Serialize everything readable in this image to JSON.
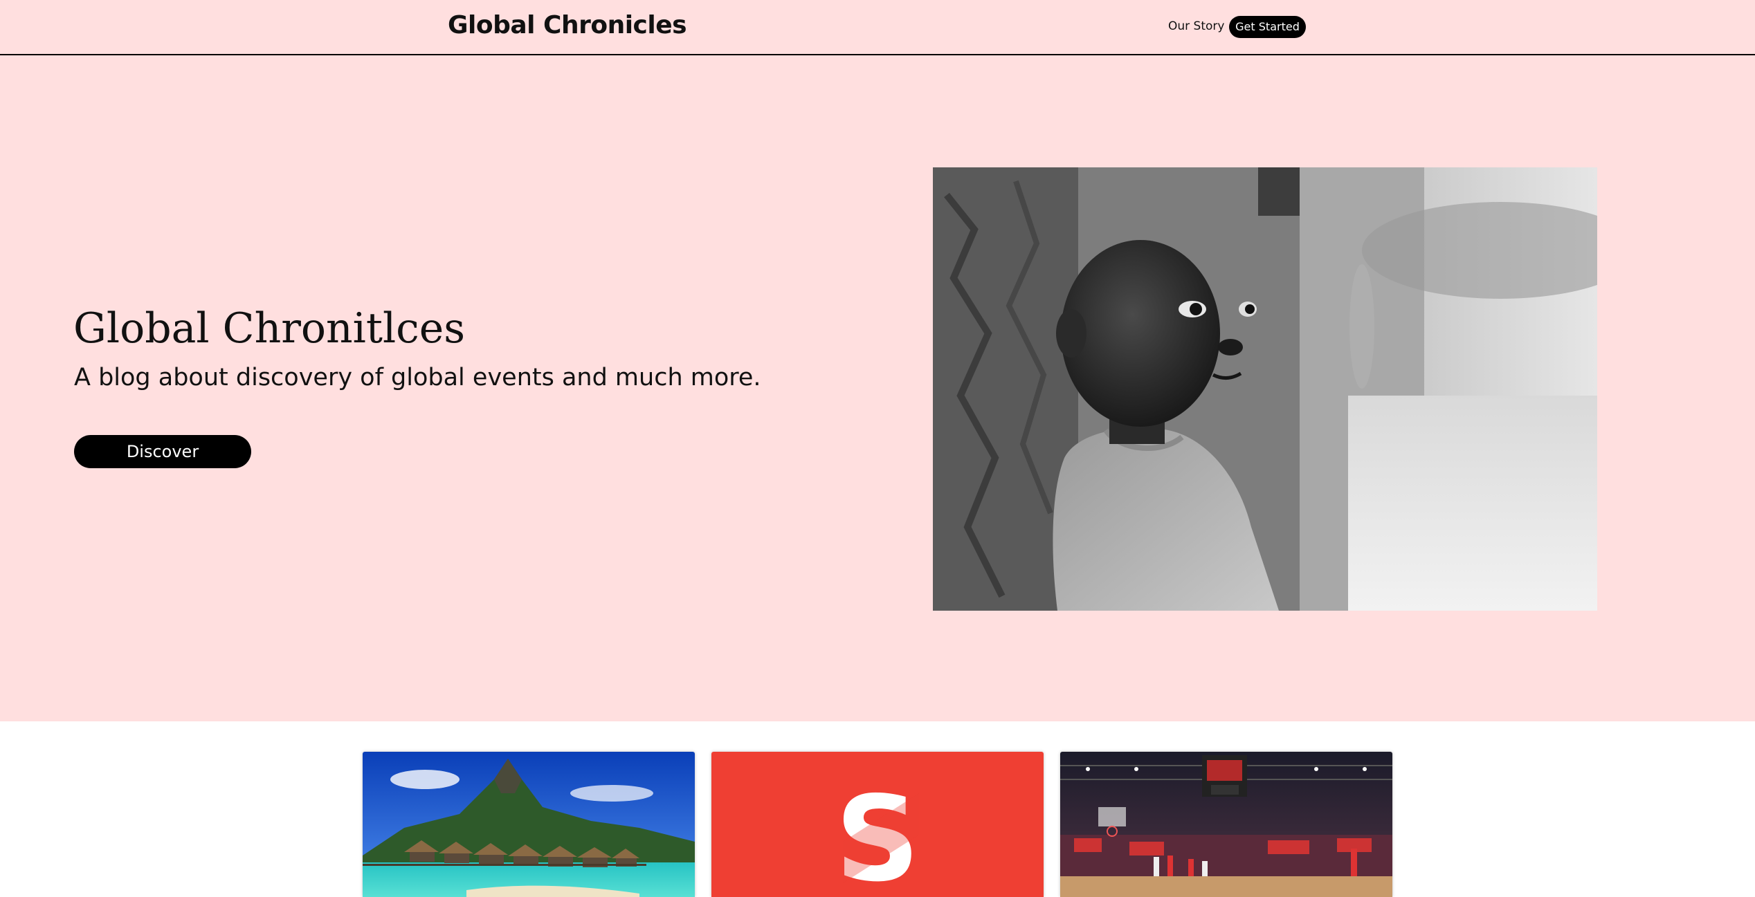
{
  "header": {
    "brand": "Global Chronicles",
    "nav_link": "Our Story",
    "cta_label": "Get Started"
  },
  "hero": {
    "title": "Global Chronitlces",
    "subtitle": "A blog about discovery of global events and much more.",
    "button_label": "Discover",
    "image_icon": "child-portrait-photo"
  },
  "cards": [
    {
      "image_icon": "tropical-island-photo"
    },
    {
      "image_icon": "s-logo-graphic",
      "logo_letter": "S"
    },
    {
      "image_icon": "basketball-arena-photo"
    }
  ],
  "colors": {
    "hero_background": "#ffdfdf",
    "button_background": "#000000",
    "card_red": "#ef3f33"
  }
}
